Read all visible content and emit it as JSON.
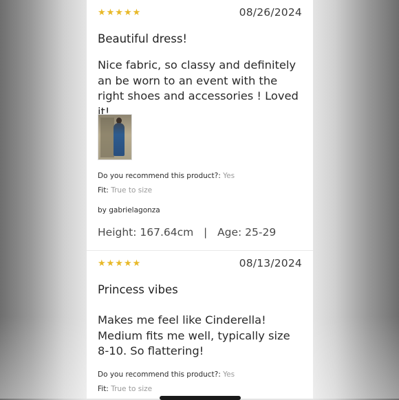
{
  "reviews": [
    {
      "rating": "★★★★★",
      "date": "08/26/2024",
      "title": "Beautiful dress!",
      "body": "Nice fabric, so classy and definitely an be worn to an event with the right shoes and accessories ! Loved it!",
      "has_photo": true,
      "recommend_label": "Do you recommend this product?:",
      "recommend_value": "Yes",
      "fit_label": "Fit:",
      "fit_value": "True to size",
      "author": "by gabrielagonza",
      "height": "Height: 167.64cm",
      "separator": "|",
      "age": "Age: 25-29"
    },
    {
      "rating": "★★★★★",
      "date": "08/13/2024",
      "title": "Princess vibes",
      "body": "Makes me feel like Cinderella! Medium fits me well, typically size 8-10. So flattering!",
      "recommend_label": "Do you recommend this product?:",
      "recommend_value": "Yes",
      "fit_label": "Fit:",
      "fit_value": "True to size"
    }
  ],
  "colors": {
    "star": "#e8b92a",
    "muted": "#9a9a9a",
    "text": "#2a2a2a"
  },
  "icons": {
    "rating": "star-icon"
  }
}
